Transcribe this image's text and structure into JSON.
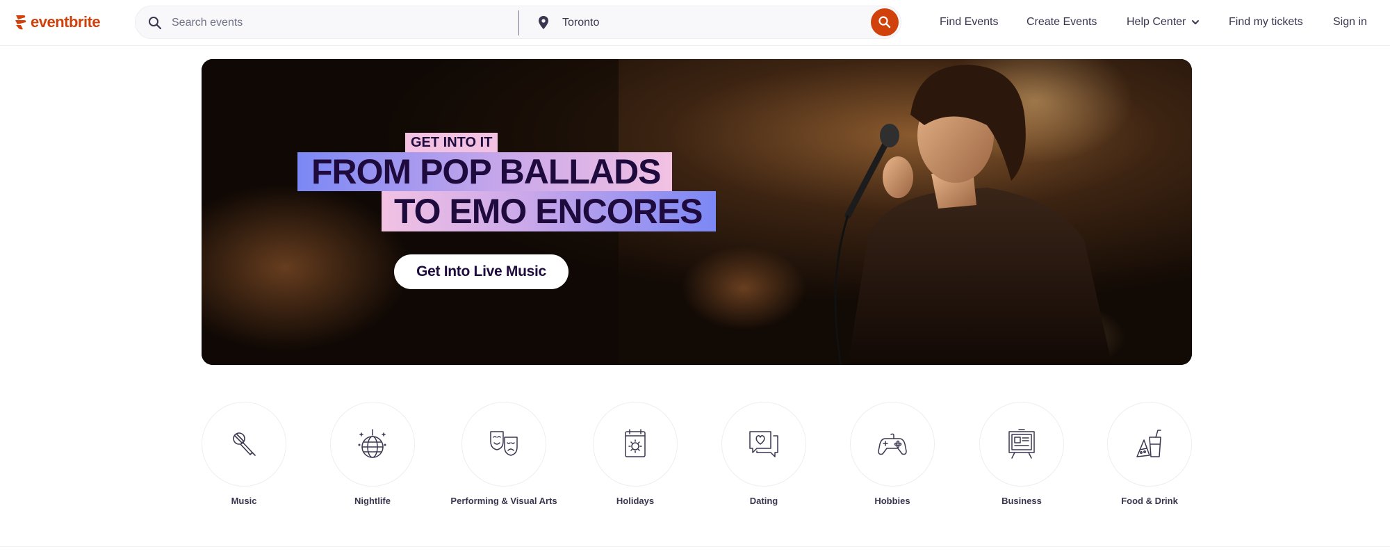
{
  "brand": {
    "name": "eventbrite",
    "color": "#d1410c"
  },
  "search": {
    "placeholder": "Search events",
    "location_value": "Toronto",
    "search_icon": "search-icon",
    "location_icon": "map-pin-icon",
    "submit_icon": "search-icon"
  },
  "nav": {
    "find_events": "Find Events",
    "create_events": "Create Events",
    "help_center": "Help Center",
    "find_tickets": "Find my tickets",
    "sign_in": "Sign in"
  },
  "hero": {
    "tag": "GET INTO IT",
    "headline_line1": "FROM POP BALLADS",
    "headline_line2": "TO EMO ENCORES",
    "cta": "Get Into Live Music",
    "image": "singer-with-microphone-on-stage"
  },
  "categories": [
    {
      "label": "Music",
      "icon": "microphone-icon"
    },
    {
      "label": "Nightlife",
      "icon": "disco-ball-icon"
    },
    {
      "label": "Performing & Visual Arts",
      "icon": "theater-masks-icon"
    },
    {
      "label": "Holidays",
      "icon": "calendar-sun-icon"
    },
    {
      "label": "Dating",
      "icon": "chat-heart-icon"
    },
    {
      "label": "Hobbies",
      "icon": "gamepad-icon"
    },
    {
      "label": "Business",
      "icon": "presentation-board-icon"
    },
    {
      "label": "Food & Drink",
      "icon": "drinks-icon"
    }
  ]
}
